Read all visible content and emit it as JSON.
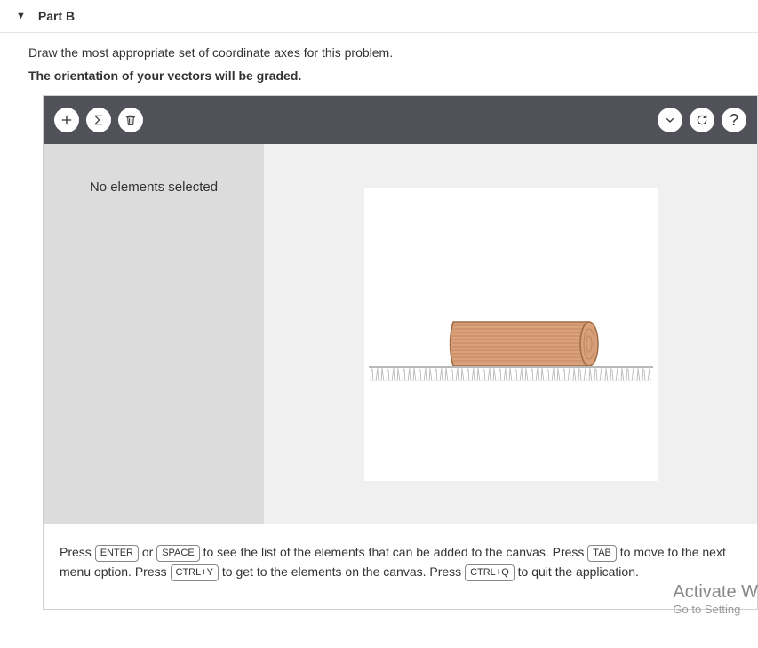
{
  "header": {
    "title": "Part B"
  },
  "instructions": {
    "line1": "Draw the most appropriate set of coordinate axes for this problem.",
    "line2": "The orientation of your vectors will be graded."
  },
  "sidebar": {
    "empty_text": "No elements selected"
  },
  "toolbar": {
    "add": "+",
    "sum": "Σ",
    "trash": "🗑",
    "chevron": "⌄",
    "reset": "↻",
    "help": "?"
  },
  "help": {
    "press1": "Press ",
    "enter": "ENTER",
    "or": " or ",
    "space": "SPACE",
    "text1": " to see the list of the elements that can be added to the canvas. Press ",
    "tab": "TAB",
    "text2": " to move to the next menu option. Press ",
    "ctrly": "CTRL+Y",
    "text3": " to get to the elements on the canvas. Press ",
    "ctrlq": "CTRL+Q",
    "text4": " to quit the application."
  },
  "watermark": {
    "line1": "Activate W",
    "line2": "Go to Setting"
  }
}
